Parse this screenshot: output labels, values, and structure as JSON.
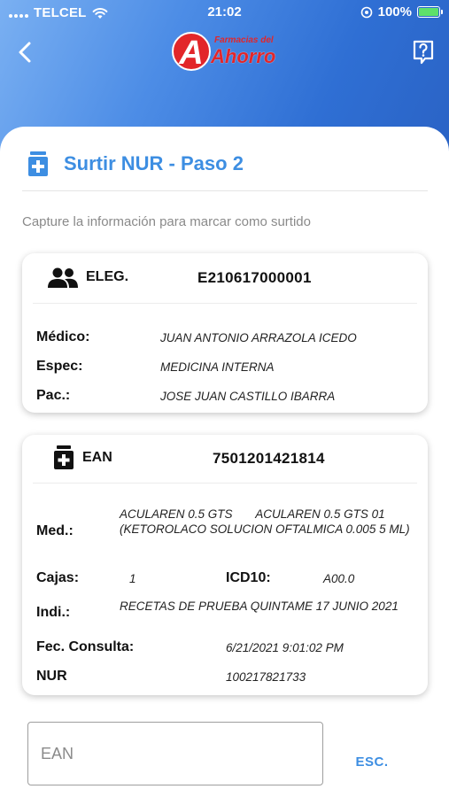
{
  "status_bar": {
    "carrier": "TELCEL",
    "time": "21:02",
    "battery": "100%"
  },
  "header": {
    "logo_small": "Farmacias del",
    "logo_main": "Ahorro",
    "logo_letter": "A"
  },
  "page": {
    "title": "Surtir NUR - Paso 2",
    "subtitle": "Capture la información para marcar como surtido"
  },
  "eleg_card": {
    "label": "ELEG.",
    "code": "E210617000001",
    "rows": [
      {
        "label": "Médico:",
        "value": "JUAN ANTONIO ARRAZOLA ICEDO"
      },
      {
        "label": "Espec:",
        "value": "MEDICINA INTERNA"
      },
      {
        "label": "Pac.:",
        "value": "JOSE JUAN CASTILLO IBARRA"
      }
    ]
  },
  "ean_card": {
    "label": "EAN",
    "code": "7501201421814",
    "med_label": "Med.:",
    "med_value": "ACULAREN 0.5 GTS       ACULAREN 0.5 GTS 01 (KETOROLACO SOLUCION OFTALMICA 0.005 5 ML)",
    "cajas_label": "Cajas:",
    "cajas_value": "1",
    "icd_label": "ICD10:",
    "icd_value": "A00.0",
    "indi_label": "Indi.:",
    "indi_value": "RECETAS DE PRUEBA QUINTAME 17 JUNIO 2021",
    "fec_label": "Fec. Consulta:",
    "fec_value": "6/21/2021 9:01:02 PM",
    "nur_label": "NUR",
    "nur_value": "100217821733"
  },
  "form": {
    "ean_placeholder": "EAN",
    "ean_value": "",
    "esc_label": "ESC."
  },
  "colors": {
    "accent": "#3d8ee2",
    "header_start": "#7ab0f2",
    "header_end": "#2a62c4",
    "logo_red": "#e2262a"
  }
}
